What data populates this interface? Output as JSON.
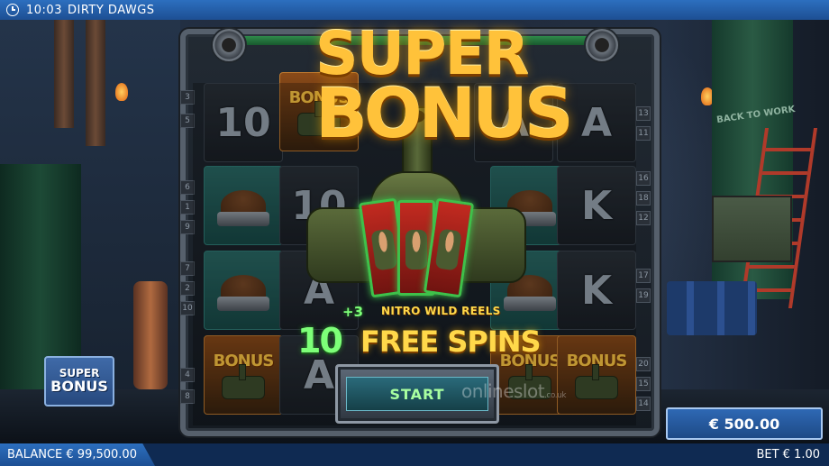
{
  "topbar": {
    "time": "10:03",
    "game_title": "DIRTY DAWGS"
  },
  "background": {
    "sign_text": "BACK TO WORK"
  },
  "reels": {
    "letters": [
      "10",
      "10",
      "A",
      "A",
      "A",
      "A",
      "K",
      "K"
    ],
    "bonus_label": "BONUS",
    "reel_numbers_left": [
      "3",
      "5",
      "6",
      "1",
      "9",
      "7",
      "2",
      "10",
      "4",
      "8"
    ],
    "reel_numbers_right": [
      "13",
      "11",
      "16",
      "18",
      "12",
      "17",
      "19",
      "20",
      "15",
      "14"
    ]
  },
  "feature": {
    "title_line1": "SUPER",
    "title_line2": "BONUS",
    "plus_wilds": "+3",
    "wild_text": "NITRO WILD REELS",
    "spins_count": "10",
    "spins_label": "FREE SPINS",
    "start_label": "START"
  },
  "watermark": {
    "main": "onlineslot",
    "suffix": ".co.uk"
  },
  "super_bonus_button": {
    "line1": "SUPER",
    "line2": "BONUS"
  },
  "win_display": "€ 500.00",
  "bottombar": {
    "balance": "BALANCE € 99,500.00",
    "bet": "BET € 1.00"
  },
  "colors": {
    "bar_blue": "#1d4f93",
    "gold": "#ffc23a",
    "green": "#7dff78"
  }
}
